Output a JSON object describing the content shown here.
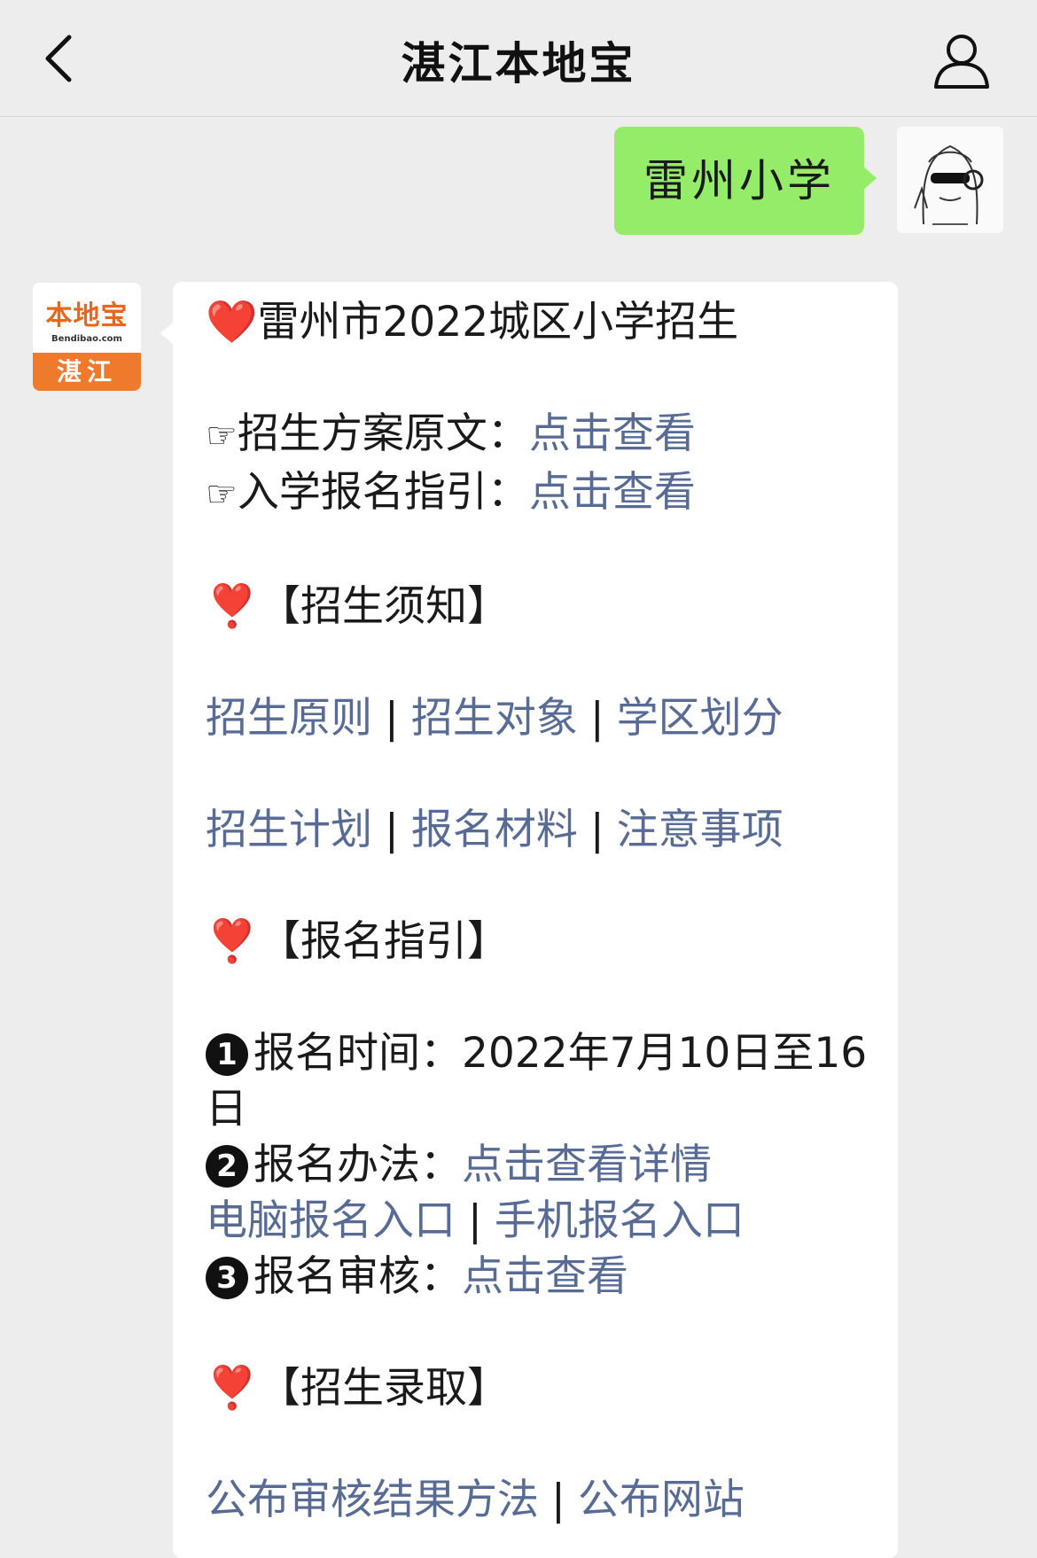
{
  "header": {
    "title": "湛江本地宝",
    "back_icon": "chevron-left-icon",
    "profile_icon": "user-icon"
  },
  "outgoing": {
    "text": "雷州小学",
    "bubble_color": "#95ec69"
  },
  "bot": {
    "logo_cn": "本地宝",
    "logo_en": "Bendibao.com",
    "city": "湛江",
    "brand_color": "#f07a2c"
  },
  "message": {
    "title_icon": "❤️",
    "title": "雷州市2022城区小学招生",
    "lines": [
      {
        "icon": "☞",
        "label": "招生方案原文：",
        "link": "点击查看"
      },
      {
        "icon": "☞",
        "label": "入学报名指引：",
        "link": "点击查看"
      }
    ],
    "sections": [
      {
        "icon": "❣️",
        "heading": "【招生须知】",
        "link_rows": [
          [
            "招生原则",
            "招生对象",
            "学区划分"
          ],
          [
            "招生计划",
            "报名材料",
            "注意事项"
          ]
        ]
      },
      {
        "icon": "❣️",
        "heading": "【报名指引】",
        "items": [
          {
            "num": "1",
            "label": "报名时间：",
            "text": "2022年7月10日至16日"
          },
          {
            "num": "2",
            "label": "报名办法：",
            "link": "点击查看详情"
          },
          {
            "links": [
              "电脑报名入口",
              "手机报名入口"
            ]
          },
          {
            "num": "3",
            "label": "报名审核：",
            "link": "点击查看"
          }
        ]
      },
      {
        "icon": "❣️",
        "heading": "【招生录取】",
        "link_rows": [
          [
            "公布审核结果方法",
            "公布网站"
          ]
        ]
      }
    ],
    "separator": "|",
    "link_color": "#576b95"
  }
}
